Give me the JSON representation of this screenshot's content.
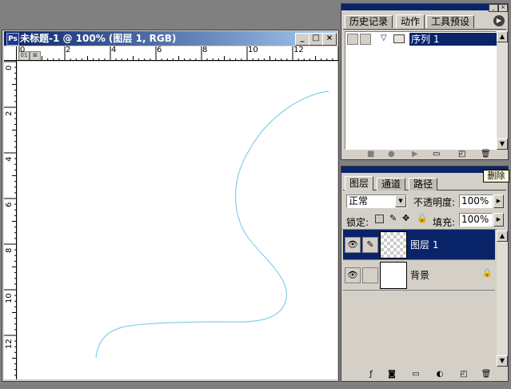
{
  "document": {
    "title": "未标题-1 @ 100% (图层 1, RGB)",
    "ruler_top_labels": [
      "0",
      "2",
      "4",
      "6",
      "8",
      "10",
      "12"
    ],
    "ruler_left_labels": [
      "0",
      "2",
      "4",
      "6",
      "8",
      "10",
      "12"
    ],
    "mini_btn_1": "01",
    "mini_btn_2": "⊠",
    "stroke_color": "#87ceeb"
  },
  "history_palette": {
    "tabs": [
      "历史记录",
      "动作",
      "工具预设"
    ],
    "active_tab": "动作",
    "items": [
      {
        "label": "序列 1",
        "selected": true
      }
    ]
  },
  "layers_palette": {
    "tabs": [
      "图层",
      "通道",
      "路径"
    ],
    "active_tab": "图层",
    "blend_mode": "正常",
    "opacity_label": "不透明度:",
    "opacity_value": "100%",
    "lock_label": "锁定:",
    "fill_label": "填充:",
    "fill_value": "100%",
    "layers": [
      {
        "name": "图层 1",
        "selected": true,
        "transparent": true,
        "locked": false
      },
      {
        "name": "背景",
        "selected": false,
        "transparent": false,
        "locked": true
      }
    ]
  },
  "tooltip": "删除",
  "colors": {
    "title_bar": "#0a246a",
    "selection": "#0a246a",
    "workspace": "#808080",
    "panel": "#d4d0c8"
  }
}
